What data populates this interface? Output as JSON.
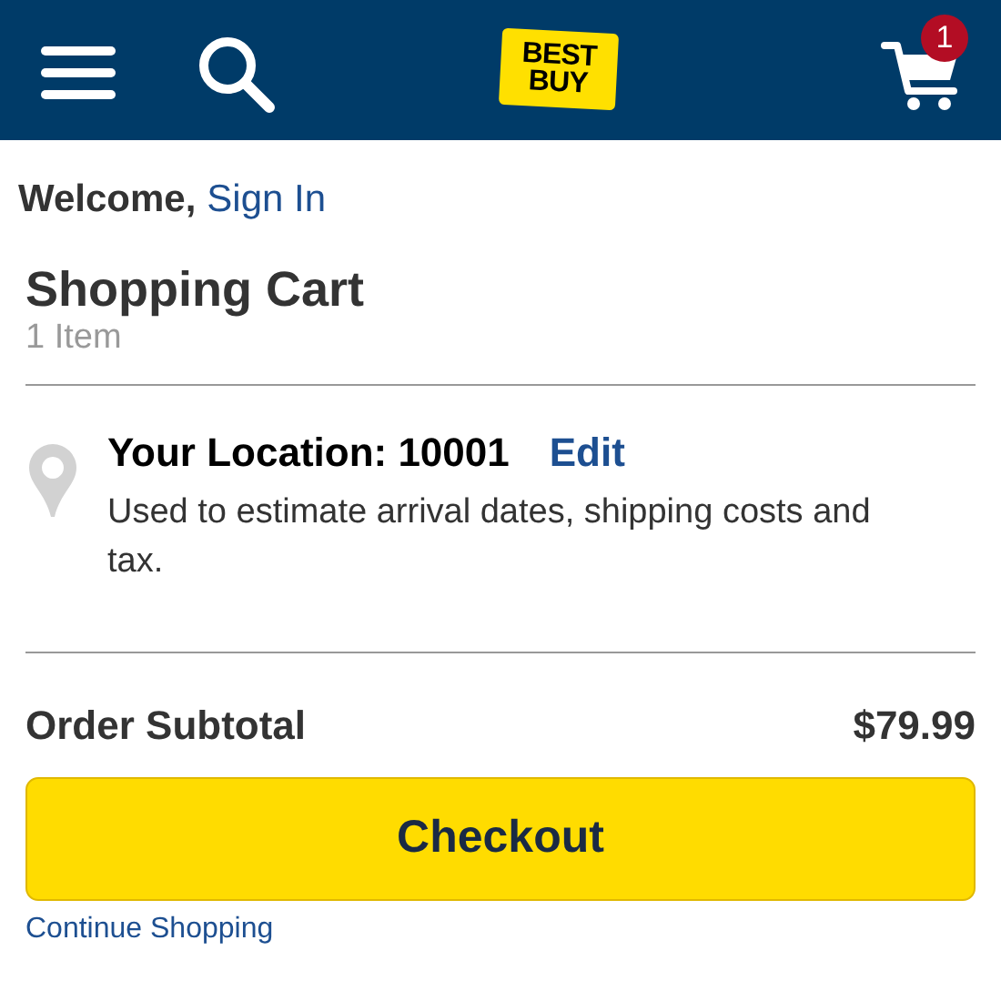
{
  "header": {
    "logo": {
      "line_1": "BEST",
      "line_2": "BUY"
    },
    "cart_count": "1"
  },
  "welcome": {
    "text": "Welcome,",
    "link": "Sign In"
  },
  "cart": {
    "title": "Shopping Cart",
    "count": "1 Item"
  },
  "location": {
    "label": "Your Location: 10001",
    "edit": "Edit",
    "note": "Used to estimate arrival dates, shipping costs and tax."
  },
  "subtotal": {
    "label": "Order Subtotal",
    "amount": "$79.99"
  },
  "checkout": "Checkout",
  "continue": "Continue Shopping"
}
